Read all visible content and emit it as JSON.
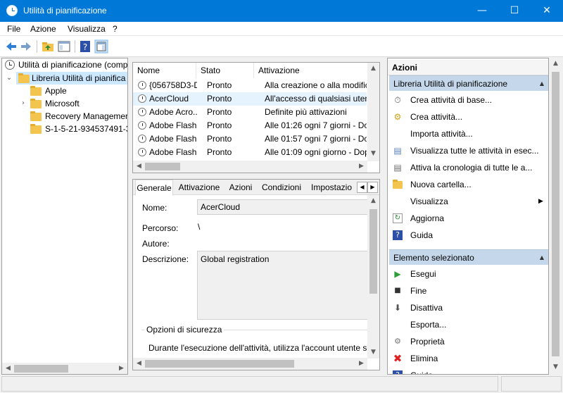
{
  "window": {
    "title": "Utilità di pianificazione"
  },
  "menu": {
    "file": "File",
    "azione": "Azione",
    "visualizza": "Visualizza",
    "help": "?"
  },
  "tree": {
    "root": "Utilità di pianificazione (comp",
    "library": "Libreria Utilità di pianifica",
    "children": [
      "Apple",
      "Microsoft",
      "Recovery Managemer",
      "S-1-5-21-934537491-3"
    ]
  },
  "tasks": {
    "columns": [
      "Nome",
      "Stato",
      "Attivazione"
    ],
    "rows": [
      {
        "name": "{056758D3-D...",
        "status": "Pronto",
        "trigger": "Alla creazione o alla modific"
      },
      {
        "name": "AcerCloud",
        "status": "Pronto",
        "trigger": "All'accesso di qualsiasi utent"
      },
      {
        "name": "Adobe Acro...",
        "status": "Pronto",
        "trigger": "Definite più attivazioni"
      },
      {
        "name": "Adobe Flash...",
        "status": "Pronto",
        "trigger": "Alle 01:26 ogni 7 giorni - Dop"
      },
      {
        "name": "Adobe Flash...",
        "status": "Pronto",
        "trigger": "Alle 01:57 ogni 7 giorni - Dop"
      },
      {
        "name": "Adobe Flash...",
        "status": "Pronto",
        "trigger": "Alle 01:09 ogni giorno - Dop"
      }
    ]
  },
  "details": {
    "tabs": [
      "Generale",
      "Attivazione",
      "Azioni",
      "Condizioni",
      "Impostazio"
    ],
    "name_label": "Nome:",
    "name_value": "AcerCloud",
    "path_label": "Percorso:",
    "path_value": "\\",
    "author_label": "Autore:",
    "description_label": "Descrizione:",
    "description_value": "Global registration",
    "security_title": "Opzioni di sicurezza",
    "security_text": "Durante l'esecuzione dell'attività, utilizza l'account utente se"
  },
  "actions": {
    "header": "Azioni",
    "section1": "Libreria Utilità di pianificazione",
    "items1": [
      {
        "icon": "create-basic-task-icon",
        "label": "Crea attività di base..."
      },
      {
        "icon": "create-task-icon",
        "label": "Crea attività..."
      },
      {
        "icon": "",
        "label": "Importa attività..."
      },
      {
        "icon": "display-running-tasks-icon",
        "label": "Visualizza tutte le attività in esec..."
      },
      {
        "icon": "enable-history-icon",
        "label": "Attiva la cronologia di tutte le a..."
      },
      {
        "icon": "new-folder-icon",
        "label": "Nuova cartella..."
      },
      {
        "icon": "",
        "label": "Visualizza"
      },
      {
        "icon": "refresh-icon",
        "label": "Aggiorna"
      },
      {
        "icon": "help-icon",
        "label": "Guida"
      }
    ],
    "section2": "Elemento selezionato",
    "items2": [
      {
        "icon": "run-icon",
        "label": "Esegui"
      },
      {
        "icon": "stop-icon",
        "label": "Fine"
      },
      {
        "icon": "disable-icon",
        "label": "Disattiva"
      },
      {
        "icon": "",
        "label": "Esporta..."
      },
      {
        "icon": "properties-icon",
        "label": "Proprietà"
      },
      {
        "icon": "delete-icon",
        "label": "Elimina"
      },
      {
        "icon": "help-icon",
        "label": "Guida"
      }
    ]
  },
  "colors": {
    "titlebar": "#0078d7",
    "section_header": "#c5d7ea",
    "selected_row": "#e5f3ff",
    "tree_selected": "#cce8ff"
  }
}
